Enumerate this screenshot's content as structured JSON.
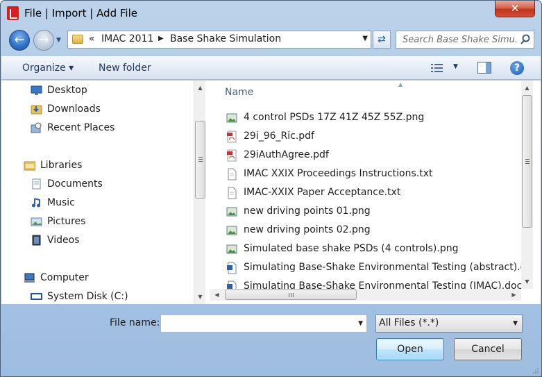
{
  "window": {
    "title": "File | Import | Add File",
    "close_label": "✕"
  },
  "nav": {
    "breadcrumb_prefix": "«",
    "breadcrumb": [
      "IMAC 2011",
      "Base Shake Simulation"
    ],
    "search_placeholder": "Search Base Shake Simu..."
  },
  "toolbar": {
    "organize_label": "Organize ▾",
    "new_folder_label": "New folder",
    "help_label": "?"
  },
  "sidebar": {
    "items": [
      {
        "label": "Desktop",
        "icon": "desktop-icon"
      },
      {
        "label": "Downloads",
        "icon": "downloads-folder-icon"
      },
      {
        "label": "Recent Places",
        "icon": "recent-places-icon"
      },
      {
        "label": "Libraries",
        "icon": "libraries-icon"
      },
      {
        "label": "Documents",
        "icon": "documents-icon"
      },
      {
        "label": "Music",
        "icon": "music-icon"
      },
      {
        "label": "Pictures",
        "icon": "pictures-icon"
      },
      {
        "label": "Videos",
        "icon": "videos-icon"
      },
      {
        "label": "Computer",
        "icon": "computer-icon"
      },
      {
        "label": "System Disk (C:)",
        "icon": "drive-icon"
      }
    ]
  },
  "files": {
    "column_name": "Name",
    "rows": [
      {
        "name": "4 control PSDs 17Z 41Z 45Z 55Z.png",
        "type": "png"
      },
      {
        "name": "29i_96_Ric.pdf",
        "type": "pdf"
      },
      {
        "name": "29iAuthAgree.pdf",
        "type": "pdf"
      },
      {
        "name": "IMAC XXIX Proceedings Instructions.txt",
        "type": "txt"
      },
      {
        "name": "IMAC-XXIX Paper Acceptance.txt",
        "type": "txt"
      },
      {
        "name": "new driving points 01.png",
        "type": "png"
      },
      {
        "name": "new driving points 02.png",
        "type": "png"
      },
      {
        "name": "Simulated base shake PSDs (4 controls).png",
        "type": "png"
      },
      {
        "name": "Simulating Base-Shake Environmental Testing (abstract).docx",
        "type": "docx"
      },
      {
        "name": "Simulating Base-Shake Environmental Testing (IMAC).docx",
        "type": "docx"
      }
    ]
  },
  "footer": {
    "file_name_label": "File name:",
    "file_name_value": "",
    "file_type_value": "All Files (*.*)",
    "open_label": "Open",
    "cancel_label": "Cancel"
  }
}
